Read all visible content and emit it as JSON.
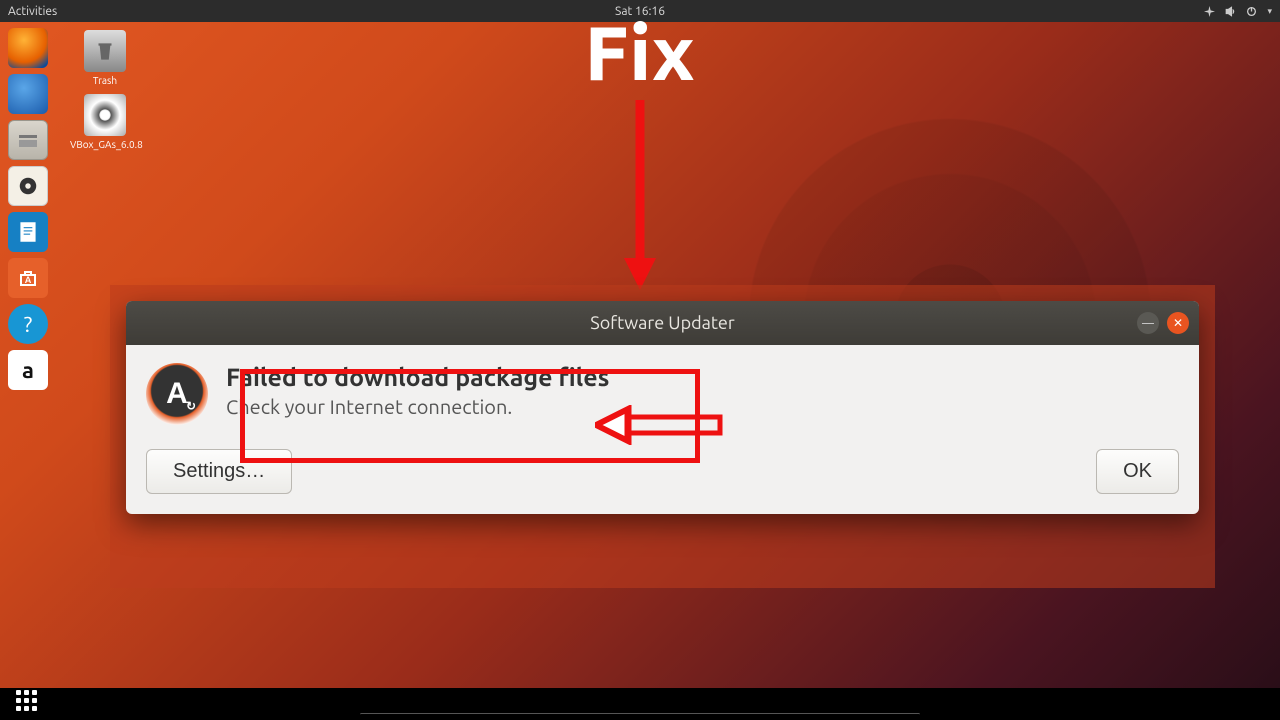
{
  "topbar": {
    "activities": "Activities",
    "clock": "Sat 16:16"
  },
  "desktop_icons": {
    "trash": "Trash",
    "vbox": "VBox_GAs_6.0.8"
  },
  "annotation": {
    "title": "Fix"
  },
  "dialog": {
    "title": "Software Updater",
    "heading": "Failed to download package files",
    "sub": "Check your Internet connection.",
    "settings_btn": "Settings…",
    "ok_btn": "OK"
  }
}
